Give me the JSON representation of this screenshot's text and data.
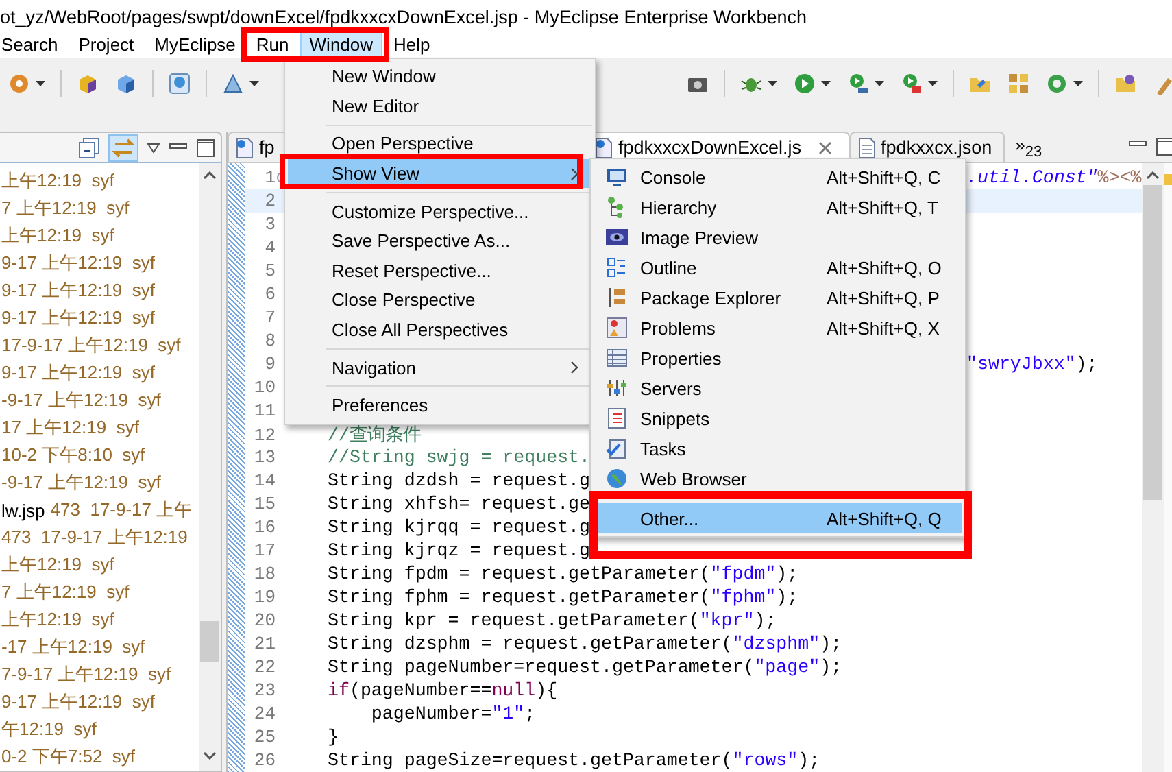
{
  "window": {
    "title": "ot_yz/WebRoot/pages/swpt/downExcel/fpdkxxcxDownExcel.jsp - MyEclipse Enterprise Workbench"
  },
  "menu_bar": [
    {
      "label": "Search",
      "selected": false
    },
    {
      "label": "Project",
      "selected": false
    },
    {
      "label": "MyEclipse",
      "selected": false
    },
    {
      "label": "Run",
      "selected": false
    },
    {
      "label": "Window",
      "selected": true
    },
    {
      "label": "Help",
      "selected": false
    }
  ],
  "explorer": {
    "rows": [
      {
        "text": "上午12:19  syf"
      },
      {
        "text": "7 上午12:19  syf"
      },
      {
        "text": "上午12:19  syf"
      },
      {
        "text": "9-17 上午12:19  syf"
      },
      {
        "text": "9-17 上午12:19  syf"
      },
      {
        "text": "9-17 上午12:19  syf"
      },
      {
        "text": "17-9-17 上午12:19  syf"
      },
      {
        "text": "9-17 上午12:19  syf"
      },
      {
        "text": "-9-17 上午12:19  syf"
      },
      {
        "text": "17 上午12:19  syf"
      },
      {
        "text": "10-2 下午8:10  syf"
      },
      {
        "text": "-9-17 上午12:19  syf"
      },
      {
        "name": "lw.jsp",
        "text": "473  17-9-17 上午"
      },
      {
        "text": "473  17-9-17 上午12:19"
      },
      {
        "text": "上午12:19  syf"
      },
      {
        "text": "7 上午12:19  syf"
      },
      {
        "text": "上午12:19  syf"
      },
      {
        "text": "-17 上午12:19  syf"
      },
      {
        "text": "7-9-17 上午12:19  syf"
      },
      {
        "text": "9-17 上午12:19  syf"
      },
      {
        "text": "午12:19  syf"
      },
      {
        "text": "0-2 下午7:52  syf"
      }
    ]
  },
  "editor": {
    "tabs": [
      {
        "label": "fp",
        "selected": false
      },
      {
        "label": "fpdkxxcxDownExcel.js",
        "selected": true
      },
      {
        "label": "fpdkxxcx.json",
        "selected": false
      }
    ],
    "overflow": {
      "label": "»",
      "count": "23"
    },
    "lines": [
      {
        "number": "1",
        "current": false,
        "tail": [
          {
            "text": ".util.Const\"",
            "kind": "attr"
          },
          {
            "text": "%><%",
            "kind": "tag"
          }
        ]
      },
      {
        "number": "2",
        "current": true
      },
      {
        "number": "3",
        "current": false
      },
      {
        "number": "4",
        "current": false
      },
      {
        "number": "5",
        "current": false
      },
      {
        "number": "6",
        "current": false
      },
      {
        "number": "7",
        "current": false
      },
      {
        "number": "8",
        "current": false
      },
      {
        "number": "9",
        "current": false,
        "tail": [
          {
            "text": "\"swryJbxx\"",
            "kind": "string"
          },
          {
            "text": ");",
            "kind": "plain"
          }
        ]
      },
      {
        "number": "10",
        "current": false
      },
      {
        "number": "11",
        "current": false
      },
      {
        "number": "12",
        "current": false,
        "code": [
          {
            "text": "//查询条件",
            "kind": "comment"
          }
        ]
      },
      {
        "number": "13",
        "current": false,
        "code": [
          {
            "text": "//String swjg = request.",
            "kind": "comment"
          }
        ]
      },
      {
        "number": "14",
        "current": false,
        "code": [
          {
            "text": "String dzdsh = request.g",
            "kind": "plain"
          }
        ]
      },
      {
        "number": "15",
        "current": false,
        "code": [
          {
            "text": "String xhfsh= request.ge",
            "kind": "plain"
          }
        ]
      },
      {
        "number": "16",
        "current": false,
        "code": [
          {
            "text": "String kjrqq = request.g",
            "kind": "plain"
          }
        ]
      },
      {
        "number": "17",
        "current": false,
        "code": [
          {
            "text": "String kjrqz = request.g",
            "kind": "plain"
          }
        ]
      },
      {
        "number": "18",
        "current": false,
        "code": [
          {
            "text": "String fpdm = request.getParameter(",
            "kind": "plain"
          },
          {
            "text": "\"fpdm\"",
            "kind": "string"
          },
          {
            "text": ");",
            "kind": "plain"
          }
        ]
      },
      {
        "number": "19",
        "current": false,
        "code": [
          {
            "text": "String fphm = request.getParameter(",
            "kind": "plain"
          },
          {
            "text": "\"fphm\"",
            "kind": "string"
          },
          {
            "text": ");",
            "kind": "plain"
          }
        ]
      },
      {
        "number": "20",
        "current": false,
        "code": [
          {
            "text": "String kpr = request.getParameter(",
            "kind": "plain"
          },
          {
            "text": "\"kpr\"",
            "kind": "string"
          },
          {
            "text": ");",
            "kind": "plain"
          }
        ]
      },
      {
        "number": "21",
        "current": false,
        "code": [
          {
            "text": "String dzsphm = request.getParameter(",
            "kind": "plain"
          },
          {
            "text": "\"dzsphm\"",
            "kind": "string"
          },
          {
            "text": ");",
            "kind": "plain"
          }
        ]
      },
      {
        "number": "22",
        "current": false,
        "code": [
          {
            "text": "String pageNumber=request.getParameter(",
            "kind": "plain"
          },
          {
            "text": "\"page\"",
            "kind": "string"
          },
          {
            "text": ");",
            "kind": "plain"
          }
        ]
      },
      {
        "number": "23",
        "current": false,
        "code": [
          {
            "text": "if",
            "kind": "keyword"
          },
          {
            "text": "(pageNumber==",
            "kind": "plain"
          },
          {
            "text": "null",
            "kind": "keyword"
          },
          {
            "text": "){",
            "kind": "plain"
          }
        ]
      },
      {
        "number": "24",
        "current": false,
        "code": [
          {
            "text": "    pageNumber=",
            "kind": "plain"
          },
          {
            "text": "\"1\"",
            "kind": "string"
          },
          {
            "text": ";",
            "kind": "plain"
          }
        ]
      },
      {
        "number": "25",
        "current": false,
        "code": [
          {
            "text": "}",
            "kind": "plain"
          }
        ]
      },
      {
        "number": "26",
        "current": false,
        "code": [
          {
            "text": "String pageSize=request.getParameter(",
            "kind": "plain"
          },
          {
            "text": "\"rows\"",
            "kind": "string"
          },
          {
            "text": ");",
            "kind": "plain"
          }
        ]
      }
    ]
  },
  "window_menu": {
    "items": [
      {
        "kind": "item",
        "label": "New Window",
        "selected": false
      },
      {
        "kind": "item",
        "label": "New Editor",
        "selected": false
      },
      {
        "kind": "separator"
      },
      {
        "kind": "item",
        "label": "Open Perspective",
        "selected": false
      },
      {
        "kind": "submenu",
        "label": "Show View",
        "selected": true
      },
      {
        "kind": "separator"
      },
      {
        "kind": "item",
        "label": "Customize Perspective...",
        "selected": false
      },
      {
        "kind": "item",
        "label": "Save Perspective As...",
        "selected": false
      },
      {
        "kind": "item",
        "label": "Reset Perspective...",
        "selected": false
      },
      {
        "kind": "item",
        "label": "Close Perspective",
        "selected": false
      },
      {
        "kind": "item",
        "label": "Close All Perspectives",
        "selected": false
      },
      {
        "kind": "separator"
      },
      {
        "kind": "submenu",
        "label": "Navigation",
        "selected": false
      },
      {
        "kind": "separator"
      },
      {
        "kind": "item",
        "label": "Preferences",
        "selected": false
      }
    ]
  },
  "show_view_menu": {
    "items": [
      {
        "kind": "item",
        "label": "Console",
        "shortcut": "Alt+Shift+Q, C",
        "selected": false
      },
      {
        "kind": "item",
        "label": "Hierarchy",
        "shortcut": "Alt+Shift+Q, T",
        "selected": false
      },
      {
        "kind": "item",
        "label": "Image Preview",
        "selected": false
      },
      {
        "kind": "item",
        "label": "Outline",
        "shortcut": "Alt+Shift+Q, O",
        "selected": false
      },
      {
        "kind": "item",
        "label": "Package Explorer",
        "shortcut": "Alt+Shift+Q, P",
        "selected": false
      },
      {
        "kind": "item",
        "label": "Problems",
        "shortcut": "Alt+Shift+Q, X",
        "selected": false
      },
      {
        "kind": "item",
        "label": "Properties",
        "selected": false
      },
      {
        "kind": "item",
        "label": "Servers",
        "selected": false
      },
      {
        "kind": "item",
        "label": "Snippets",
        "selected": false
      },
      {
        "kind": "item",
        "label": "Tasks",
        "selected": false
      },
      {
        "kind": "item",
        "label": "Web Browser",
        "selected": false
      },
      {
        "kind": "separator"
      },
      {
        "kind": "item",
        "label": "Other...",
        "shortcut": "Alt+Shift+Q, Q",
        "selected": true
      }
    ]
  }
}
